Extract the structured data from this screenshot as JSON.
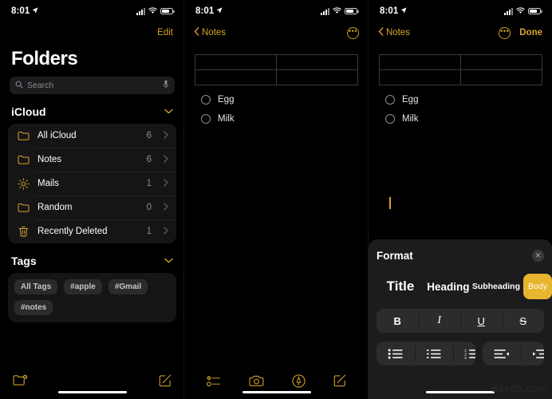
{
  "statusbar": {
    "time": "8:01",
    "location_icon": "location-arrow-icon",
    "signal_icon": "cellular-signal-icon",
    "wifi_icon": "wifi-icon",
    "battery_icon": "battery-icon"
  },
  "folders_panel": {
    "edit_label": "Edit",
    "title": "Folders",
    "search": {
      "placeholder": "Search",
      "search_icon": "search-icon",
      "mic_icon": "microphone-icon"
    },
    "icloud_section": {
      "title": "iCloud",
      "collapse_icon": "chevron-down-icon",
      "items": [
        {
          "icon": "folder-icon",
          "label": "All iCloud",
          "count": "6",
          "chevron": "chevron-right-icon"
        },
        {
          "icon": "folder-icon",
          "label": "Notes",
          "count": "6",
          "chevron": "chevron-right-icon"
        },
        {
          "icon": "gear-icon",
          "label": "Mails",
          "count": "1",
          "chevron": "chevron-right-icon"
        },
        {
          "icon": "folder-icon",
          "label": "Random",
          "count": "0",
          "chevron": "chevron-right-icon"
        },
        {
          "icon": "trash-icon",
          "label": "Recently Deleted",
          "count": "1",
          "chevron": "chevron-right-icon"
        }
      ]
    },
    "tags_section": {
      "title": "Tags",
      "collapse_icon": "chevron-down-icon",
      "chips": [
        "All Tags",
        "#apple",
        "#Gmail",
        "#notes"
      ]
    },
    "toolbar": {
      "new_folder_icon": "new-folder-icon",
      "compose_icon": "compose-note-icon"
    }
  },
  "note_panel": {
    "back_label": "Notes",
    "back_icon": "chevron-left-icon",
    "more_icon": "more-ellipsis-icon",
    "table": {
      "rows": 2,
      "cols": 2,
      "cells": [
        [
          "",
          ""
        ],
        [
          "",
          ""
        ]
      ]
    },
    "checklist": [
      {
        "label": "Egg",
        "checked": false
      },
      {
        "label": "Milk",
        "checked": false
      }
    ],
    "toolbar": {
      "checklist_icon": "checklist-icon",
      "camera_icon": "camera-icon",
      "markup_icon": "markup-pen-icon",
      "compose_icon": "compose-note-icon"
    }
  },
  "editor_panel": {
    "back_label": "Notes",
    "back_icon": "chevron-left-icon",
    "more_icon": "more-ellipsis-icon",
    "done_label": "Done",
    "table": {
      "rows": 2,
      "cols": 2,
      "cells": [
        [
          "",
          ""
        ],
        [
          "",
          ""
        ]
      ]
    },
    "checklist": [
      {
        "label": "Egg",
        "checked": false
      },
      {
        "label": "Milk",
        "checked": false
      }
    ],
    "cursor": "text-caret",
    "format_sheet": {
      "title": "Format",
      "close_icon": "close-icon",
      "styles": [
        {
          "label": "Title",
          "selected": false
        },
        {
          "label": "Heading",
          "selected": false
        },
        {
          "label": "Subheading",
          "selected": false
        },
        {
          "label": "Body",
          "selected": true
        }
      ],
      "text_styles": [
        {
          "label": "B",
          "name": "bold-button"
        },
        {
          "label": "I",
          "name": "italic-button"
        },
        {
          "label": "U",
          "name": "underline-button"
        },
        {
          "label": "S",
          "name": "strikethrough-button"
        }
      ],
      "list_buttons": [
        {
          "icon": "bulleted-list-icon"
        },
        {
          "icon": "dashed-list-icon"
        },
        {
          "icon": "numbered-list-icon"
        }
      ],
      "indent_buttons": [
        {
          "icon": "outdent-icon"
        },
        {
          "icon": "indent-icon"
        }
      ]
    }
  },
  "colors": {
    "accent": "#d5a429",
    "highlight": "#e8b52e",
    "card": "#151516",
    "sheet": "#1c1c1e"
  },
  "watermark": "wsxdn.com"
}
